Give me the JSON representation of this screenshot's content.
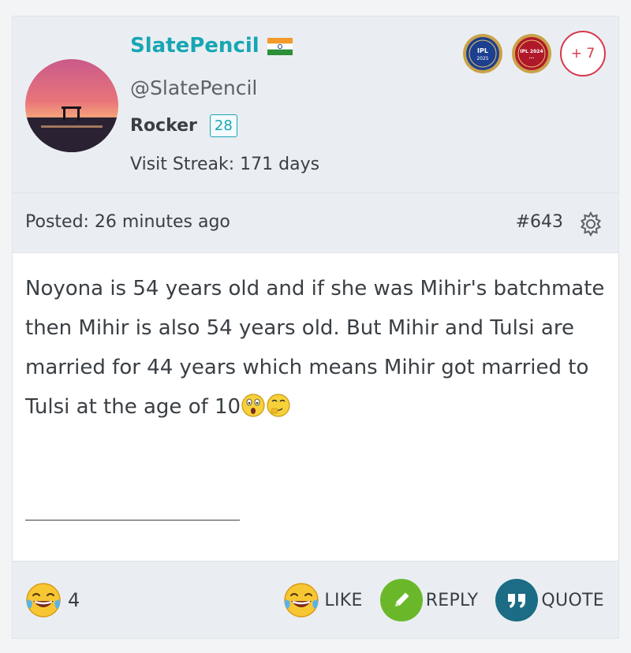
{
  "user": {
    "name": "SlatePencil",
    "handle": "@SlatePencil",
    "rank": "Rocker",
    "level": "28",
    "visit_streak": "Visit Streak: 171 days"
  },
  "badges": {
    "items": [
      {
        "label": "IPL 2025",
        "color": "#1c3f8f"
      },
      {
        "label": "IPL 2024",
        "color": "#b0182a"
      }
    ],
    "more": "+ 7"
  },
  "post": {
    "posted": "Posted: 26 minutes ago",
    "number": "#643",
    "text": "Noyona is 54 years old and if she was Mihir's batchmate then Mihir is also 54 years old. But Mihir and Tulsi are married for 44 years which means Mihir got married to Tulsi at the age of 10"
  },
  "reactions": {
    "count": "4"
  },
  "actions": {
    "like": "LIKE",
    "reply": "REPLY",
    "quote": "QUOTE"
  },
  "colors": {
    "accent": "#17a6b4",
    "reply": "#6ab82a",
    "quote": "#1b6c84",
    "badge_border": "#d8374a"
  }
}
